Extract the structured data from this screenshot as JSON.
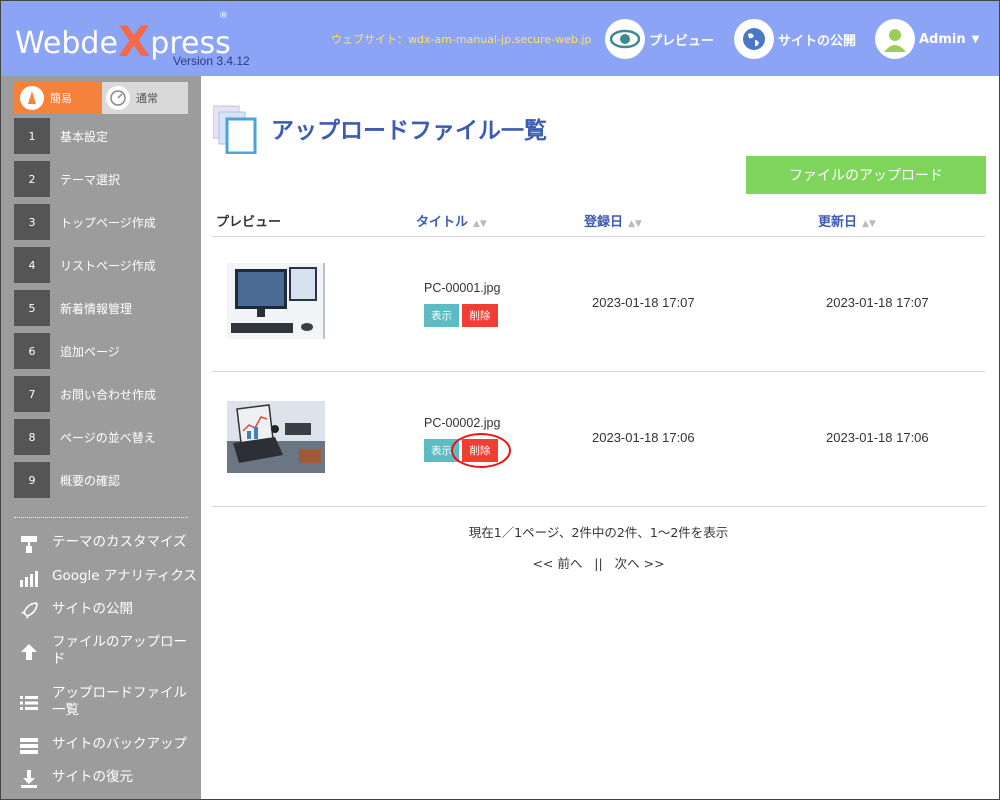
{
  "header": {
    "logo_prefix": "Webde",
    "logo_x": "X",
    "logo_suffix": "press",
    "logo_reg": "®",
    "version": "Version 3.4.12",
    "website": "ウェブサイト：wdx-am-manual-jp.secure-web.jp",
    "preview_label": "プレビュー",
    "publish_label": "サイトの公開",
    "admin_label": "Admin",
    "preview_icon": "eye-icon",
    "publish_icon": "globe-icon",
    "admin_icon": "user-avatar-icon"
  },
  "sidebar": {
    "modes": [
      {
        "label": "簡易",
        "icon": "wizard-icon",
        "active": true
      },
      {
        "label": "通常",
        "icon": "gauge-icon",
        "active": false
      }
    ],
    "steps": [
      {
        "num": "1",
        "label": "基本設定"
      },
      {
        "num": "2",
        "label": "テーマ選択"
      },
      {
        "num": "3",
        "label": "トップページ作成"
      },
      {
        "num": "4",
        "label": "リストページ作成"
      },
      {
        "num": "5",
        "label": "新着情報管理"
      },
      {
        "num": "6",
        "label": "追加ページ"
      },
      {
        "num": "7",
        "label": "お問い合わせ作成"
      },
      {
        "num": "8",
        "label": "ページの並べ替え"
      },
      {
        "num": "9",
        "label": "概要の確認"
      }
    ],
    "tools": [
      {
        "label": "テーマのカスタマイズ",
        "icon": "paint-roller-icon"
      },
      {
        "label": "Google アナリティクス",
        "icon": "bar-chart-icon"
      },
      {
        "label": "サイトの公開",
        "icon": "rocket-icon"
      },
      {
        "label": "ファイルのアップロード",
        "icon": "upload-icon"
      },
      {
        "label": "アップロードファイル一覧",
        "icon": "list-icon"
      },
      {
        "label": "サイトのバックアップ",
        "icon": "server-icon"
      },
      {
        "label": "サイトの復元",
        "icon": "download-icon"
      }
    ]
  },
  "main": {
    "title": "アップロードファイル一覧",
    "title_icon": "files-icon",
    "upload_button": "ファイルのアップロード",
    "columns": {
      "preview": "プレビュー",
      "title": "タイトル",
      "registered": "登録日",
      "updated": "更新日"
    },
    "rows": [
      {
        "name": "PC-00001.jpg",
        "show": "表示",
        "delete": "削除",
        "registered": "2023-01-18 17:07",
        "updated": "2023-01-18 17:07",
        "thumb": "desktop-computer-photo"
      },
      {
        "name": "PC-00002.jpg",
        "show": "表示",
        "delete": "削除",
        "registered": "2023-01-18 17:06",
        "updated": "2023-01-18 17:06",
        "thumb": "laptop-chart-photo"
      }
    ],
    "pager": {
      "info": "現在1／1ページ、2件中の2件、1～2件を表示",
      "prev": "<< 前へ",
      "sep": "||",
      "next": "次へ >>"
    }
  }
}
